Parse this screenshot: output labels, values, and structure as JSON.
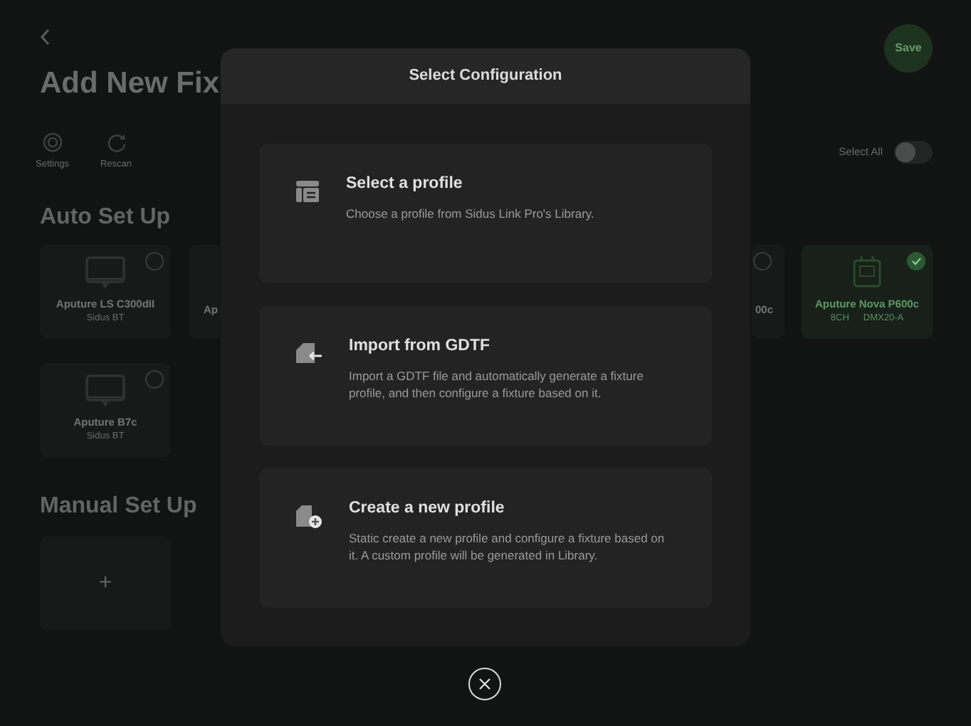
{
  "header": {
    "title": "Add New Fix",
    "save_button": "Save"
  },
  "toolbar": [
    {
      "kind": "settings",
      "label": "Settings"
    },
    {
      "kind": "rescan",
      "label": "Rescan"
    }
  ],
  "select_all": {
    "label": "Select All",
    "on": false
  },
  "auto_setup": {
    "heading": "Auto Set Up",
    "rows": [
      {
        "left": [
          {
            "kind": "card",
            "name": "Aputure LS C300dII",
            "details": [
              "Sidus BT"
            ],
            "selected": false
          },
          {
            "kind": "stub",
            "name": "Ap"
          }
        ],
        "right": [
          {
            "kind": "stub",
            "name": "00c",
            "selected": false
          },
          {
            "kind": "card",
            "name": "Aputure Nova P600c",
            "details": [
              "8CH",
              "DMX20-A"
            ],
            "selected": true
          }
        ]
      },
      {
        "left": [
          {
            "kind": "card",
            "name": "Aputure B7c",
            "details": [
              "Sidus BT"
            ],
            "selected": false
          }
        ]
      }
    ]
  },
  "manual_setup": {
    "heading": "Manual Set Up",
    "add_label": "+"
  },
  "modal": {
    "title": "Select Configuration",
    "options": [
      {
        "kind": "select",
        "title": "Select a profile",
        "description": "Choose a profile from Sidus Link Pro's Library."
      },
      {
        "kind": "import",
        "title": "Import from GDTF",
        "description": "Import a GDTF file and automatically generate a fixture profile, and then configure a fixture based on it."
      },
      {
        "kind": "create",
        "title": "Create a new profile",
        "description": "Static create a new profile and configure a fixture based on it. A custom profile will be generated in Library."
      }
    ]
  }
}
